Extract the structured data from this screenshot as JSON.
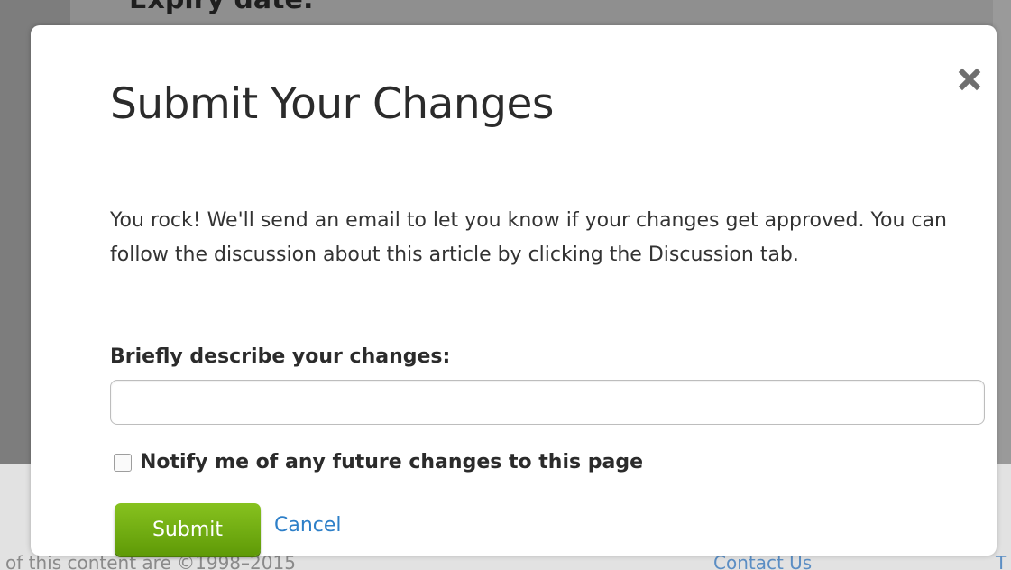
{
  "background": {
    "heading": "Expiry date:",
    "footer_copyright": "of this content are ©1998–2015",
    "footer_contact": "Contact Us",
    "footer_partial": "T"
  },
  "modal": {
    "title": "Submit Your Changes",
    "close_icon": "close-x-icon",
    "message": "You rock! We'll send an email to let you know if your changes get approved. You can follow the discussion about this article by clicking the Discussion tab.",
    "description_label": "Briefly describe your changes:",
    "description_value": "",
    "notify_label": "Notify me of any future changes to this page",
    "notify_checked": false,
    "submit_label": "Submit",
    "cancel_label": "Cancel"
  },
  "colors": {
    "submit_button": "#6fad0f",
    "cancel_link": "#2d7fc8",
    "title_text": "#2b2b2b"
  }
}
